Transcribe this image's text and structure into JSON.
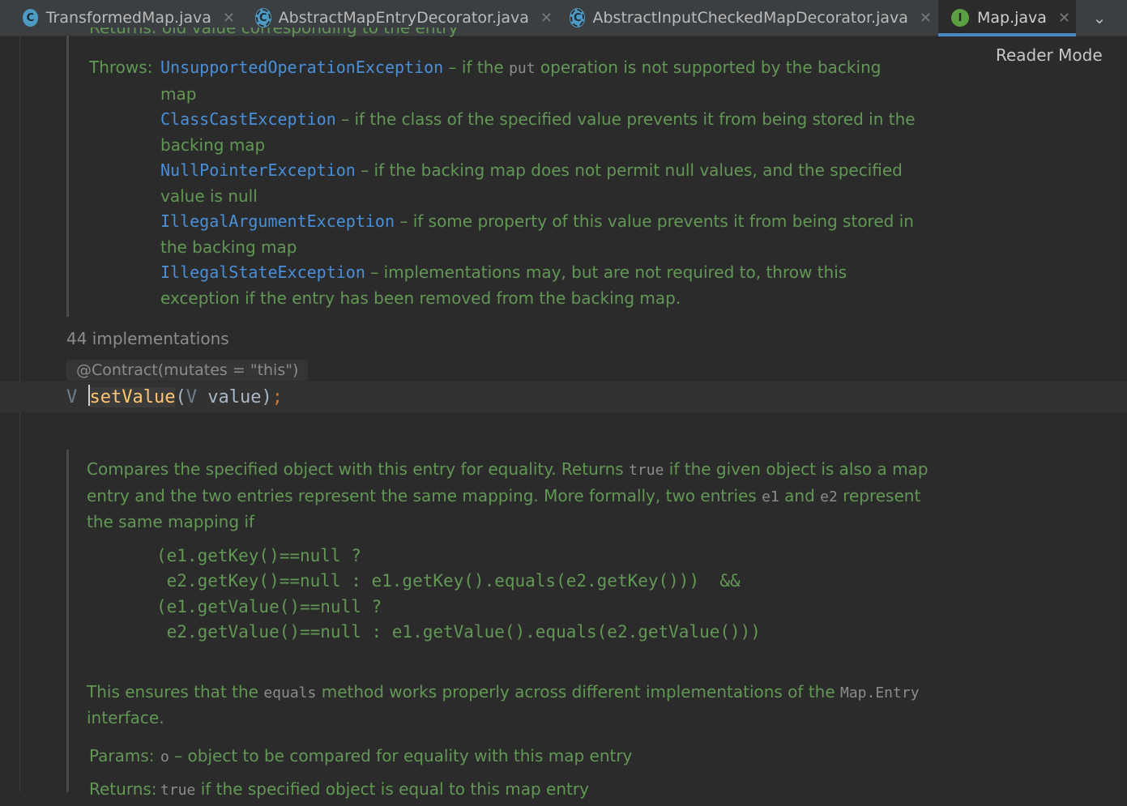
{
  "tabs": [
    {
      "label": "TransformedMap.java",
      "icon": "class-icon",
      "active": false
    },
    {
      "label": "AbstractMapEntryDecorator.java",
      "icon": "abstract-class-icon",
      "active": false
    },
    {
      "label": "AbstractInputCheckedMapDecorator.java",
      "icon": "abstract-class-icon",
      "active": false
    },
    {
      "label": "Map.java",
      "icon": "interface-icon",
      "active": true
    }
  ],
  "icon_glyphs": {
    "class": "C",
    "abstract": "C",
    "interface": "I",
    "close": "✕",
    "chevron": "⌄"
  },
  "reader_mode": "Reader Mode",
  "doc1": {
    "returns_cut": "Returns: old value corresponding to the entry",
    "throws_label": "Throws:",
    "exceptions": [
      {
        "name": "UnsupportedOperationException",
        "pre": " – if the ",
        "code": "put",
        "post": " operation is not supported by the backing",
        "line2": "map"
      },
      {
        "name": "ClassCastException",
        "text": " – if the class of the specified value prevents it from being stored in the",
        "line2": "backing map"
      },
      {
        "name": "NullPointerException",
        "text": " – if the backing map does not permit null values, and the specified",
        "line2": "value is null"
      },
      {
        "name": "IllegalArgumentException",
        "text": " – if some property of this value prevents it from being stored in",
        "line2": "the backing map"
      },
      {
        "name": "IllegalStateException",
        "text": " – implementations may, but are not required to, throw this",
        "line2": "exception if the entry has been removed from the backing map."
      }
    ]
  },
  "implementations": "44 implementations",
  "contract": "@Contract(mutates = \"this\")",
  "code": {
    "return_type": "V",
    "method": "setValue",
    "open": "(",
    "param_type": "V",
    "param": " value",
    "close": ")",
    "semi": ";"
  },
  "doc2": {
    "p1_a": "Compares the specified object with this entry for equality. Returns ",
    "p1_code1": "true",
    "p1_b": " if the given object is also a map",
    "p1_c": "entry and the two entries represent the same mapping. More formally, two entries ",
    "p1_code2": "e1",
    "p1_d": " and ",
    "p1_code3": "e2",
    "p1_e": " represent",
    "p1_f": "the same mapping if",
    "code_lines": [
      "(e1.getKey()==null ?",
      " e2.getKey()==null : e1.getKey().equals(e2.getKey()))  &&",
      "(e1.getValue()==null ?",
      " e2.getValue()==null : e1.getValue().equals(e2.getValue()))"
    ],
    "p2_a": "This ensures that the ",
    "p2_code1": "equals",
    "p2_b": " method works properly across different implementations of the ",
    "p2_code2": "Map.Entry",
    "p2_c": "interface.",
    "params_label": "Params:",
    "params_code": "o",
    "params_text": " – object to be compared for equality with this map entry",
    "returns_label": "Returns:",
    "returns_code": "true",
    "returns_text": " if the specified object is equal to this map entry"
  }
}
